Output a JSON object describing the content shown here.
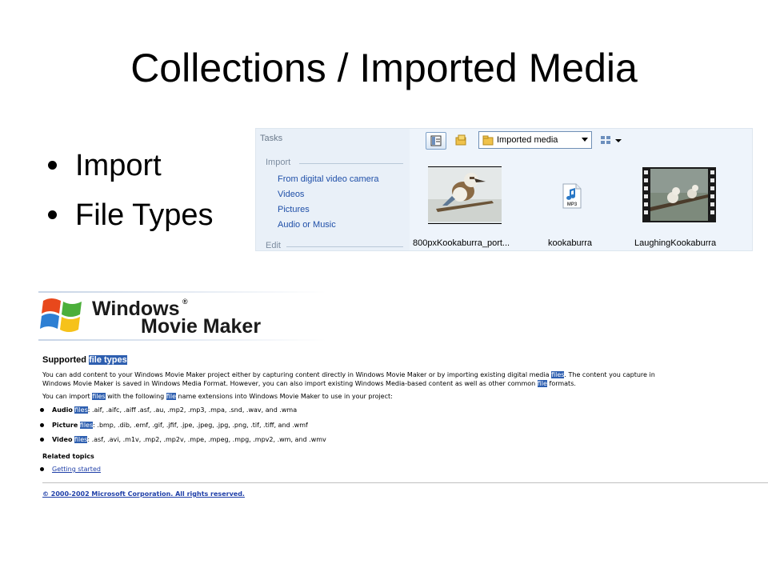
{
  "slide": {
    "title": "Collections / Imported Media",
    "bullets": [
      "Import",
      "File Types"
    ]
  },
  "collections_panel": {
    "tasks_title": "Tasks",
    "import_section": "Import",
    "import_links": [
      "From digital video camera",
      "Videos",
      "Pictures",
      "Audio or Music"
    ],
    "edit_section": "Edit",
    "collection_dropdown": "Imported media",
    "media_items": [
      {
        "label": "800pxKookaburra_port...",
        "icon": "photo-thumbnail"
      },
      {
        "label": "kookaburra",
        "icon": "mp3-file-icon"
      },
      {
        "label": "LaughingKookaburra",
        "icon": "video-film-thumbnail"
      }
    ]
  },
  "help_page": {
    "logo_line1": "Windows",
    "logo_registered": "®",
    "logo_line2": "Movie Maker",
    "heading_plain": "Supported ",
    "heading_highlight": "file types",
    "para1_a": "You can add content to your Windows Movie Maker project either by capturing content directly in Windows Movie Maker or by importing existing digital media ",
    "para1_hl1": "files",
    "para1_b": ". The content you capture in",
    "para1_c": "Windows Movie Maker is saved in Windows Media Format. However, you can also import existing Windows Media-based content as well as other common ",
    "para1_hl2": "file",
    "para1_d": " formats.",
    "para2_a": "You can import ",
    "para2_hl1": "files",
    "para2_b": " with the following ",
    "para2_hl2": "file",
    "para2_c": " name extensions into Windows Movie Maker to use in your project:",
    "types": [
      {
        "name": "Audio",
        "hl": "files",
        "exts": ": .aif, .aifc, .aiff .asf, .au, .mp2, .mp3, .mpa, .snd, .wav, and .wma"
      },
      {
        "name": "Picture",
        "hl": "files",
        "exts": ": .bmp, .dib, .emf, .gif, .jfif, .jpe, .jpeg, .jpg, .png, .tif, .tiff, and .wmf"
      },
      {
        "name": "Video",
        "hl": "files",
        "exts": ": .asf, .avi, .m1v, .mp2, .mp2v, .mpe, .mpeg, .mpg, .mpv2, .wm, and .wmv"
      }
    ],
    "related_heading": "Related topics",
    "related_link": "Getting started",
    "copyright": "© 2000-2002 Microsoft Corporation. All rights reserved."
  },
  "colors": {
    "highlight": "#2e5fb0",
    "link": "#1f4fa8",
    "panel_bg": "#eef4fb"
  }
}
